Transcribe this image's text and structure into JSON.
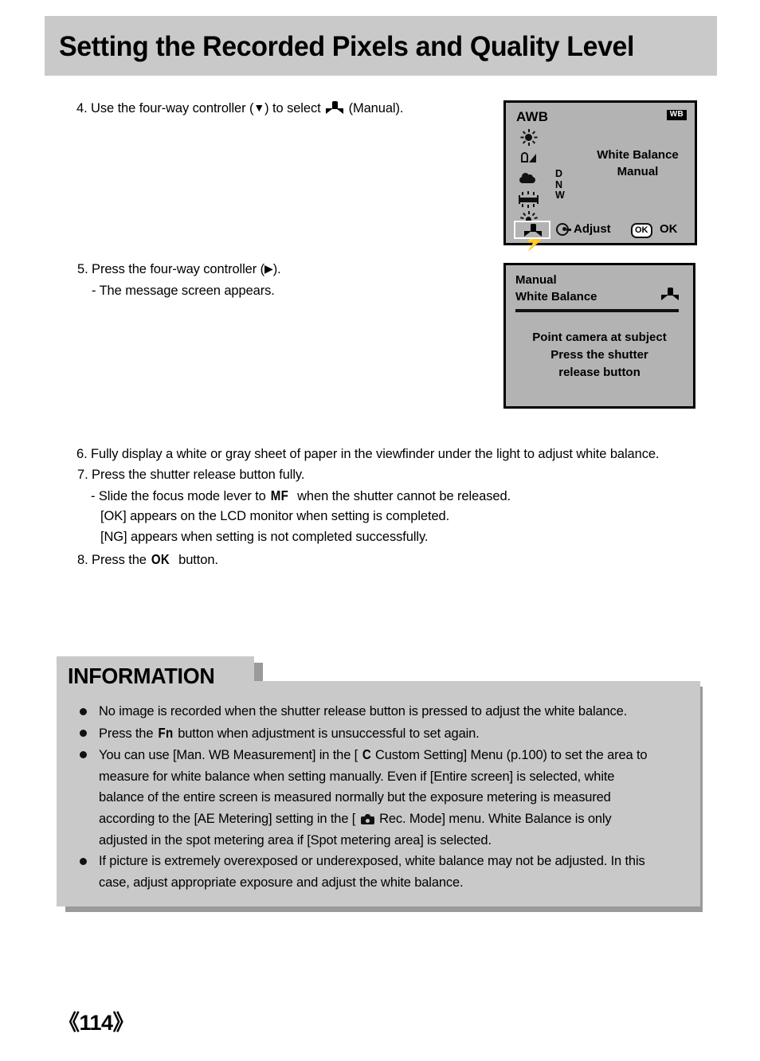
{
  "page": {
    "title": "Setting the Recorded Pixels and Quality Level",
    "number": "《114》"
  },
  "steps": {
    "step4_a": "4. Use the four-way controller (",
    "step4_tri": "▼",
    "step4_b": ") to select",
    "step4_c": "(Manual).",
    "step5_a": "5. Press the four-way controller (",
    "step5_tri": "▶",
    "step5_b": ").",
    "step5_sub": "- The message screen appears.",
    "step6": "6. Fully display a white or gray sheet of paper in the viewfinder under the light to adjust white balance.",
    "step7": "7. Press the shutter release button fully.",
    "step7_sub1_a": "- Slide the focus mode lever to",
    "step7_sub1_mf": "MF",
    "step7_sub1_b": "when the shutter cannot be released.",
    "step7_sub2": "[OK] appears on the LCD monitor when setting is completed.",
    "step7_sub3": "[NG] appears when setting is not completed successfully.",
    "step8_a": "8. Press the",
    "step8_ok": "OK",
    "step8_b": "button."
  },
  "lcd_wb_screen": {
    "awb_label": "AWB",
    "wb_badge": "WB",
    "title_line1": "White Balance",
    "title_line2": "Manual",
    "dnw": "D\nN\nW",
    "dnw_d": "D",
    "dnw_n": "N",
    "dnw_w": "W",
    "adjust_label": "Adjust",
    "ok_badge": "OK",
    "ok_label": "OK",
    "icons": [
      "daylight-sun-icon",
      "shade-icon",
      "cloudy-icon",
      "fluorescent-icon",
      "tungsten-icon",
      "flash-icon",
      "manual-wb-icon"
    ]
  },
  "lcd_message_screen": {
    "title_line1": "Manual",
    "title_line2": "White Balance",
    "body_line1": "Point camera at subject",
    "body_line2": "Press the shutter",
    "body_line3": "release button"
  },
  "information": {
    "heading": "INFORMATION",
    "items": {
      "item1": "No image is recorded when the shutter release button is pressed to adjust the white balance.",
      "item2_a": "Press the",
      "item2_fn": "Fn",
      "item2_b": "button when adjustment is unsuccessful to set again.",
      "item3_a": "You can use [Man. WB Measurement] in the [",
      "item3_c_glyph": "C",
      "item3_b": "Custom Setting] Menu (p.100) to set the area to",
      "item3_line2": "measure for white balance when setting manually. Even if [Entire screen] is selected, white",
      "item3_line3": "balance of the entire screen is measured normally but the exposure metering is measured",
      "item3_line4_a": "according to the [AE Metering] setting in the [",
      "item3_line4_b": "Rec. Mode] menu. White Balance is only",
      "item3_line5": "adjusted in the spot metering area if [Spot metering area] is selected.",
      "item4_line1": "If picture is extremely overexposed or underexposed, white balance may not be adjusted. In this",
      "item4_line2": "case, adjust appropriate exposure and adjust the white balance."
    }
  },
  "colors": {
    "band_gray": "#c9c9c9",
    "shadow_gray": "#9a9a9a",
    "lcd_gray": "#b3b3b3",
    "ink": "#000000"
  }
}
